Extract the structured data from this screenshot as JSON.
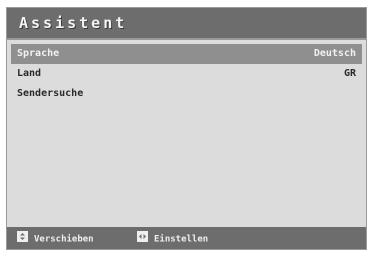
{
  "screen_title": "Assistent",
  "menu": {
    "items": [
      {
        "label": "Sprache",
        "value": "Deutsch",
        "selected": true
      },
      {
        "label": "Land",
        "value": "GR",
        "selected": false
      },
      {
        "label": "Sendersuche",
        "value": "",
        "selected": false
      }
    ]
  },
  "footer": {
    "move": {
      "icon": "up-down-key-icon",
      "label": "Verschieben"
    },
    "set": {
      "icon": "left-right-key-icon",
      "label": "Einstellen"
    }
  },
  "colors": {
    "title_bar": "#6d6d6d",
    "panel_bg": "#dcdcdc",
    "selected_row": "#8f8f8f",
    "footer_bar": "#6d6d6d"
  }
}
